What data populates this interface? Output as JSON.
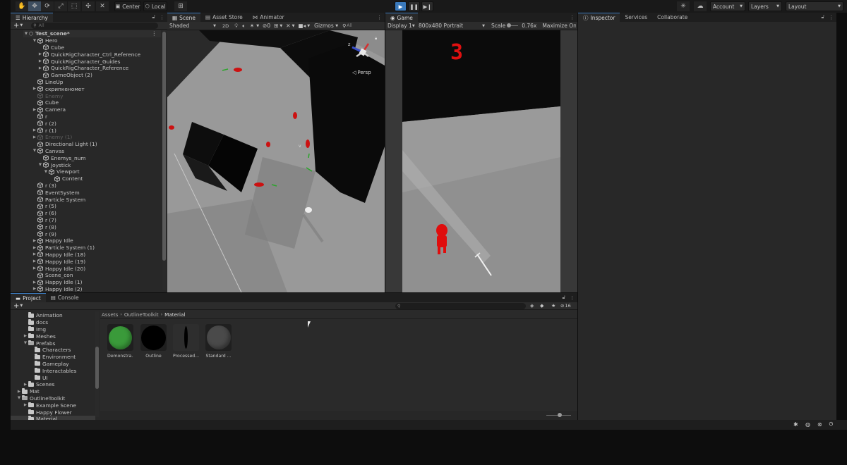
{
  "toolbar": {
    "center_label": "Center",
    "local_label": "Local",
    "account_label": "Account",
    "layers_label": "Layers",
    "layout_label": "Layout"
  },
  "hierarchy": {
    "tab_label": "Hierarchy",
    "search_placeholder": "All",
    "scene_name": "Test_scene*",
    "items": [
      {
        "label": "Hero",
        "indent": 1,
        "arrow": "open",
        "dim": false
      },
      {
        "label": "Cube",
        "indent": 2,
        "arrow": "",
        "dim": false
      },
      {
        "label": "QuickRigCharacter_Ctrl_Reference",
        "indent": 2,
        "arrow": "closed",
        "dim": false
      },
      {
        "label": "QuickRigCharacter_Guides",
        "indent": 2,
        "arrow": "closed",
        "dim": false
      },
      {
        "label": "QuickRigCharacter_Reference",
        "indent": 2,
        "arrow": "closed",
        "dim": false
      },
      {
        "label": "GameObject (2)",
        "indent": 2,
        "arrow": "",
        "dim": false
      },
      {
        "label": "LineUp",
        "indent": 1,
        "arrow": "",
        "dim": false
      },
      {
        "label": "скрипкеномет",
        "indent": 1,
        "arrow": "closed",
        "dim": false
      },
      {
        "label": "Enemy",
        "indent": 1,
        "arrow": "",
        "dim": true
      },
      {
        "label": "Cube",
        "indent": 1,
        "arrow": "",
        "dim": false
      },
      {
        "label": "Camera",
        "indent": 1,
        "arrow": "closed",
        "dim": false
      },
      {
        "label": "r",
        "indent": 1,
        "arrow": "",
        "dim": false
      },
      {
        "label": "r (2)",
        "indent": 1,
        "arrow": "",
        "dim": false
      },
      {
        "label": "r (1)",
        "indent": 1,
        "arrow": "closed",
        "dim": false
      },
      {
        "label": "Enemy (1)",
        "indent": 1,
        "arrow": "closed",
        "dim": true
      },
      {
        "label": "Directional Light (1)",
        "indent": 1,
        "arrow": "",
        "dim": false
      },
      {
        "label": "Canvas",
        "indent": 1,
        "arrow": "open",
        "dim": false
      },
      {
        "label": "Enemys_num",
        "indent": 2,
        "arrow": "",
        "dim": false
      },
      {
        "label": "Joystick",
        "indent": 2,
        "arrow": "open",
        "dim": false
      },
      {
        "label": "Viewport",
        "indent": 3,
        "arrow": "open",
        "dim": false
      },
      {
        "label": "Content",
        "indent": 4,
        "arrow": "",
        "dim": false
      },
      {
        "label": "r (3)",
        "indent": 1,
        "arrow": "",
        "dim": false
      },
      {
        "label": "EventSystem",
        "indent": 1,
        "arrow": "",
        "dim": false
      },
      {
        "label": "Particle System",
        "indent": 1,
        "arrow": "",
        "dim": false
      },
      {
        "label": "r (5)",
        "indent": 1,
        "arrow": "",
        "dim": false
      },
      {
        "label": "r (6)",
        "indent": 1,
        "arrow": "",
        "dim": false
      },
      {
        "label": "r (7)",
        "indent": 1,
        "arrow": "",
        "dim": false
      },
      {
        "label": "r (8)",
        "indent": 1,
        "arrow": "",
        "dim": false
      },
      {
        "label": "r (9)",
        "indent": 1,
        "arrow": "",
        "dim": false
      },
      {
        "label": "Happy Idle",
        "indent": 1,
        "arrow": "closed",
        "dim": false
      },
      {
        "label": "Particle System (1)",
        "indent": 1,
        "arrow": "closed",
        "dim": false
      },
      {
        "label": "Happy Idle (18)",
        "indent": 1,
        "arrow": "closed",
        "dim": false
      },
      {
        "label": "Happy Idle (19)",
        "indent": 1,
        "arrow": "closed",
        "dim": false
      },
      {
        "label": "Happy Idle (20)",
        "indent": 1,
        "arrow": "closed",
        "dim": false
      },
      {
        "label": "Scene_con",
        "indent": 1,
        "arrow": "",
        "dim": false
      },
      {
        "label": "Happy Idle (1)",
        "indent": 1,
        "arrow": "closed",
        "dim": false
      },
      {
        "label": "Happy Idle (2)",
        "indent": 1,
        "arrow": "closed",
        "dim": false
      }
    ]
  },
  "scene": {
    "tabs": [
      "Scene",
      "Asset Store",
      "Animator"
    ],
    "shading": "Shaded",
    "mode_2d": "2D",
    "gizmos": "Gizmos",
    "all_label": "All",
    "persp_label": "Persp",
    "gizmo_axis_z": "z"
  },
  "game": {
    "tab_label": "Game",
    "display": "Display 1",
    "resolution": "800x480 Portrait",
    "scale_label": "Scale",
    "scale_value": "0.76x",
    "maximize": "Maximize On Play",
    "counter": "3"
  },
  "inspector": {
    "tabs": [
      "Inspector",
      "Services",
      "Collaborate"
    ]
  },
  "project": {
    "tabs": [
      "Project",
      "Console"
    ],
    "breadcrumb": [
      "Assets",
      "OutlineToolkit",
      "Material"
    ],
    "badge": "16",
    "folders": [
      {
        "label": "Animation",
        "indent": 1,
        "arrow": "",
        "open": false
      },
      {
        "label": "docs",
        "indent": 1,
        "arrow": "",
        "open": false
      },
      {
        "label": "Img",
        "indent": 1,
        "arrow": "",
        "open": false
      },
      {
        "label": "Meshes",
        "indent": 1,
        "arrow": "closed",
        "open": false
      },
      {
        "label": "Prefabs",
        "indent": 1,
        "arrow": "open",
        "open": true
      },
      {
        "label": "Characters",
        "indent": 2,
        "arrow": "",
        "open": false
      },
      {
        "label": "Environment",
        "indent": 2,
        "arrow": "",
        "open": false
      },
      {
        "label": "Gameplay",
        "indent": 2,
        "arrow": "",
        "open": false
      },
      {
        "label": "Interactables",
        "indent": 2,
        "arrow": "",
        "open": false
      },
      {
        "label": "UI",
        "indent": 2,
        "arrow": "",
        "open": false
      },
      {
        "label": "Scenes",
        "indent": 1,
        "arrow": "closed",
        "open": false
      },
      {
        "label": "Mat",
        "indent": 0,
        "arrow": "closed",
        "open": false
      },
      {
        "label": "OutlineToolkit",
        "indent": 0,
        "arrow": "open",
        "open": true
      },
      {
        "label": "Example Scene",
        "indent": 1,
        "arrow": "closed",
        "open": false
      },
      {
        "label": "Happy Flower",
        "indent": 1,
        "arrow": "",
        "open": false
      },
      {
        "label": "Material",
        "indent": 1,
        "arrow": "",
        "open": false
      }
    ],
    "materials": [
      {
        "label": "Demonstra...",
        "color": "#3a9a3a"
      },
      {
        "label": "Outline",
        "color": "#000000"
      },
      {
        "label": "Processed...",
        "color": "#2e2e2e"
      },
      {
        "label": "Standard ...",
        "color": "#4a4a4a"
      }
    ]
  }
}
